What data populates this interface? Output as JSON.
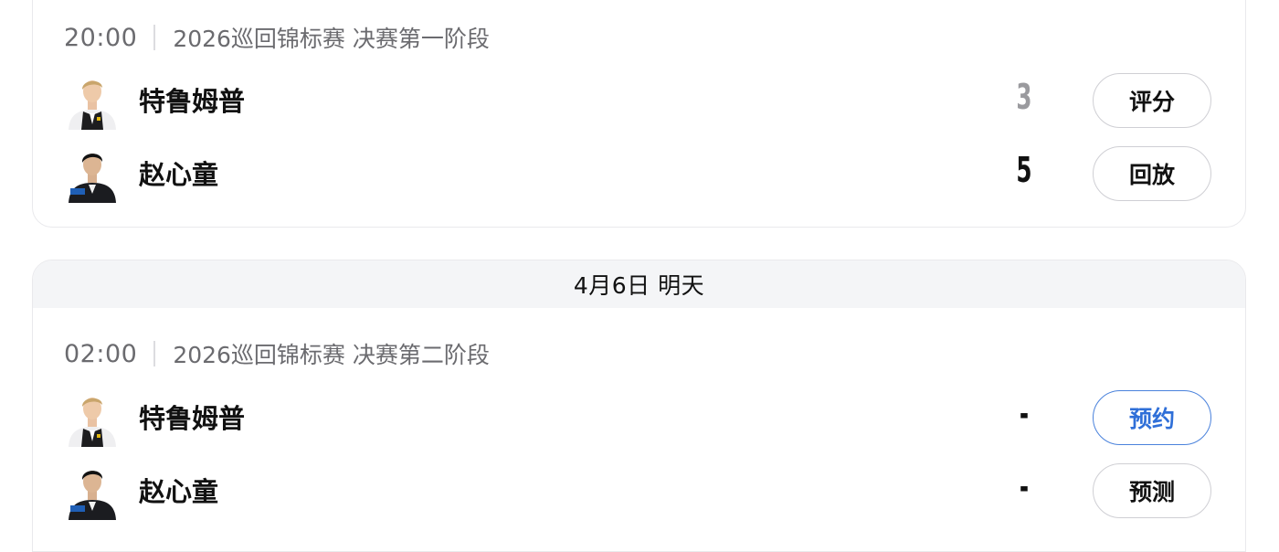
{
  "colors": {
    "accent_blue": "#2f6fd8",
    "muted_score": "#9a9a9e",
    "header_bg": "#f4f5f7"
  },
  "matches": [
    {
      "time": "20:00",
      "event": "2026巡回锦标赛 决赛第一阶段",
      "players": [
        {
          "name": "特鲁姆普",
          "score": "3",
          "action": "评分",
          "avatar_icon": "player-avatar-trump"
        },
        {
          "name": "赵心童",
          "score": "5",
          "action": "回放",
          "avatar_icon": "player-avatar-zhao"
        }
      ]
    },
    {
      "date_header": "4月6日 明天",
      "time": "02:00",
      "event": "2026巡回锦标赛 决赛第二阶段",
      "players": [
        {
          "name": "特鲁姆普",
          "score": "-",
          "action": "预约",
          "avatar_icon": "player-avatar-trump"
        },
        {
          "name": "赵心童",
          "score": "-",
          "action": "预测",
          "avatar_icon": "player-avatar-zhao"
        }
      ]
    }
  ]
}
